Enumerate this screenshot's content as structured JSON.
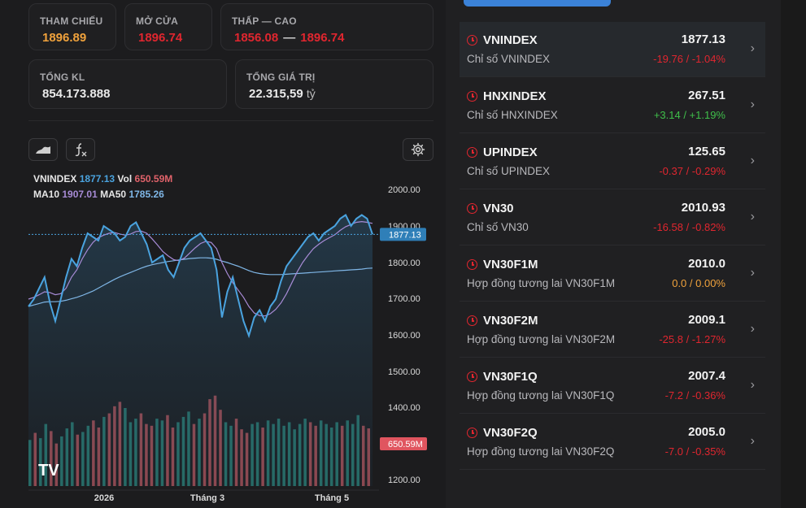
{
  "stats": {
    "ref_label": "THAM CHIẾU",
    "ref_value": "1896.89",
    "open_label": "MỞ CỬA",
    "open_value": "1896.74",
    "range_label": "THẤP — CAO",
    "low_value": "1856.08",
    "range_sep": "—",
    "high_value": "1896.74",
    "vol_label": "TỔNG KL",
    "vol_value": "854.173.888",
    "val_label": "TỔNG GIÁ TRỊ",
    "val_value": "22.315,59",
    "val_unit": "tỷ"
  },
  "toolbar": {
    "chart_type_icon": "area-chart-icon",
    "indicator_icon": "fx-icon",
    "settings_icon": "gear-icon"
  },
  "chart": {
    "legend_symbol": "VNINDEX",
    "legend_price": "1877.13",
    "legend_vol_label": "Vol",
    "legend_vol": "650.59M",
    "ma10_label": "MA10",
    "ma10_value": "1907.01",
    "ma50_label": "MA50",
    "ma50_value": "1785.26",
    "price_tag": "1877.13",
    "vol_tag": "650.59M",
    "watermark": "TV"
  },
  "chart_data": {
    "type": "line",
    "title": "VNINDEX",
    "x_tick_labels": [
      "2026",
      "Tháng 3",
      "Tháng 5"
    ],
    "y_tick_labels": [
      "2000.00",
      "1900.00",
      "1800.00",
      "1700.00",
      "1600.00",
      "1500.00",
      "1400.00",
      "1200.00"
    ],
    "ylim": [
      1200,
      2000
    ],
    "series": [
      {
        "name": "VNINDEX",
        "values": [
          1680,
          1700,
          1730,
          1760,
          1690,
          1640,
          1700,
          1760,
          1810,
          1790,
          1840,
          1880,
          1870,
          1860,
          1900,
          1890,
          1880,
          1860,
          1870,
          1900,
          1910,
          1880,
          1850,
          1800,
          1810,
          1820,
          1780,
          1760,
          1800,
          1840,
          1860,
          1870,
          1880,
          1860,
          1840,
          1780,
          1650,
          1720,
          1760,
          1700,
          1640,
          1600,
          1650,
          1670,
          1640,
          1680,
          1700,
          1750,
          1790,
          1810,
          1830,
          1850,
          1870,
          1880,
          1860,
          1880,
          1890,
          1900,
          1920,
          1930,
          1900,
          1920,
          1930,
          1920,
          1877
        ]
      },
      {
        "name": "MA10",
        "values": [
          1700,
          1705,
          1712,
          1720,
          1718,
          1712,
          1715,
          1730,
          1760,
          1780,
          1810,
          1835,
          1855,
          1868,
          1875,
          1880,
          1882,
          1878,
          1875,
          1878,
          1885,
          1886,
          1880,
          1865,
          1848,
          1830,
          1818,
          1808,
          1805,
          1812,
          1826,
          1840,
          1852,
          1858,
          1855,
          1838,
          1800,
          1770,
          1745,
          1725,
          1705,
          1680,
          1662,
          1655,
          1654,
          1660,
          1672,
          1690,
          1715,
          1745,
          1775,
          1800,
          1820,
          1838,
          1850,
          1860,
          1868,
          1876,
          1888,
          1898,
          1904,
          1910,
          1912,
          1910,
          1907
        ]
      },
      {
        "name": "MA50",
        "values": [
          1680,
          1684,
          1688,
          1692,
          1693,
          1693,
          1694,
          1697,
          1701,
          1705,
          1710,
          1716,
          1722,
          1730,
          1738,
          1746,
          1754,
          1761,
          1767,
          1773,
          1779,
          1785,
          1790,
          1794,
          1797,
          1800,
          1803,
          1805,
          1807,
          1809,
          1811,
          1812,
          1813,
          1813,
          1812,
          1809,
          1804,
          1800,
          1795,
          1790,
          1784,
          1778,
          1773,
          1770,
          1768,
          1767,
          1767,
          1767,
          1768,
          1769,
          1770,
          1771,
          1772,
          1773,
          1774,
          1775,
          1776,
          1777,
          1778,
          1779,
          1780,
          1781,
          1782,
          1784,
          1785
        ]
      }
    ],
    "volume_values": [
      520,
      600,
      540,
      700,
      620,
      480,
      560,
      650,
      720,
      580,
      610,
      680,
      740,
      660,
      780,
      820,
      900,
      950,
      880,
      720,
      760,
      820,
      700,
      680,
      760,
      740,
      800,
      660,
      720,
      780,
      840,
      700,
      760,
      820,
      980,
      1020,
      860,
      720,
      680,
      760,
      640,
      600,
      700,
      720,
      660,
      740,
      700,
      760,
      680,
      720,
      640,
      700,
      760,
      720,
      680,
      740,
      700,
      660,
      720,
      680,
      740,
      700,
      800,
      680,
      650.59
    ],
    "volume_up": [
      1,
      0,
      1,
      1,
      0,
      0,
      1,
      1,
      1,
      0,
      1,
      1,
      0,
      0,
      1,
      0,
      0,
      0,
      1,
      1,
      1,
      0,
      0,
      0,
      1,
      1,
      0,
      0,
      1,
      1,
      1,
      0,
      1,
      0,
      0,
      0,
      0,
      1,
      1,
      0,
      0,
      0,
      1,
      1,
      0,
      1,
      1,
      1,
      1,
      1,
      1,
      1,
      1,
      0,
      0,
      1,
      1,
      1,
      1,
      0,
      1,
      1,
      1,
      0,
      0
    ]
  },
  "watchlist": [
    {
      "symbol": "VNINDEX",
      "name": "Chỉ số VNINDEX",
      "price": "1877.13",
      "change": "-19.76 / -1.04%",
      "dir": "down",
      "active": true
    },
    {
      "symbol": "HNXINDEX",
      "name": "Chỉ số HNXINDEX",
      "price": "267.51",
      "change": "+3.14 / +1.19%",
      "dir": "up",
      "active": false
    },
    {
      "symbol": "UPINDEX",
      "name": "Chỉ số UPINDEX",
      "price": "125.65",
      "change": "-0.37 / -0.29%",
      "dir": "down",
      "active": false
    },
    {
      "symbol": "VN30",
      "name": "Chỉ số VN30",
      "price": "2010.93",
      "change": "-16.58 / -0.82%",
      "dir": "down",
      "active": false
    },
    {
      "symbol": "VN30F1M",
      "name": "Hợp đồng tương lai VN30F1M",
      "price": "2010.0",
      "change": "0.0 / 0.00%",
      "dir": "flat",
      "active": false
    },
    {
      "symbol": "VN30F2M",
      "name": "Hợp đồng tương lai VN30F2M",
      "price": "2009.1",
      "change": "-25.8 / -1.27%",
      "dir": "down",
      "active": false
    },
    {
      "symbol": "VN30F1Q",
      "name": "Hợp đồng tương lai VN30F1Q",
      "price": "2007.4",
      "change": "-7.2 / -0.36%",
      "dir": "down",
      "active": false
    },
    {
      "symbol": "VN30F2Q",
      "name": "Hợp đồng tương lai VN30F2Q",
      "price": "2005.0",
      "change": "-7.0 / -0.35%",
      "dir": "down",
      "active": false
    }
  ],
  "colors": {
    "up": "#3fbf4a",
    "down": "#e0262f",
    "flat": "#f0a23c",
    "line": "#4aa3df",
    "ma10": "#a78bd6",
    "ma50": "#7fb6e6",
    "vol_up": "#2f9c8f",
    "vol_down": "#e0626a"
  }
}
